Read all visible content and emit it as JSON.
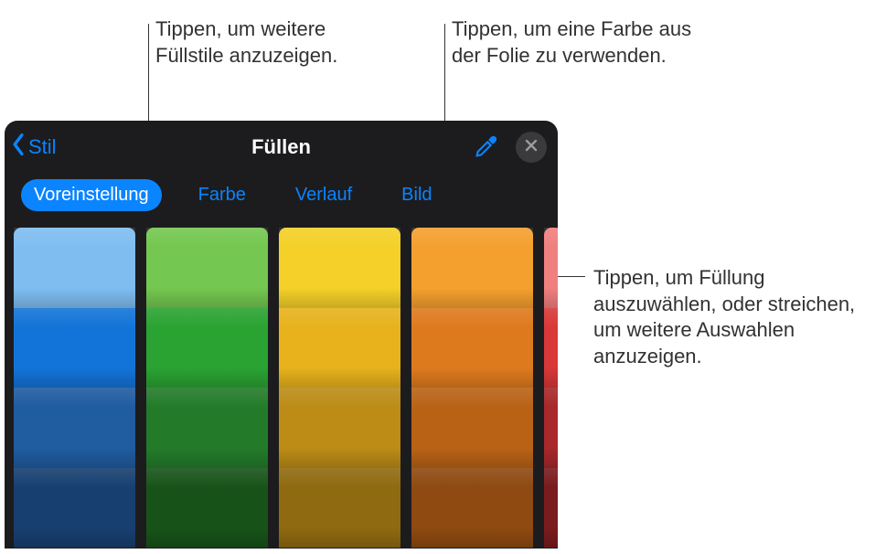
{
  "callouts": {
    "fillStyles": "Tippen, um weitere Füllstile anzuzeigen.",
    "eyedropper": "Tippen, um eine Farbe aus der Folie zu verwenden.",
    "swatches": "Tippen, um Füllung auszuwählen, oder streichen, um weitere Auswahlen anzuzeigen."
  },
  "panel": {
    "back_label": "Stil",
    "title": "Füllen",
    "tabs": [
      "Voreinstellung",
      "Farbe",
      "Verlauf",
      "Bild"
    ],
    "active_tab_index": 0,
    "swatch_columns": [
      [
        "#7fbdf0",
        "#1274d8",
        "#1f5ca0",
        "#173f70"
      ],
      [
        "#74c750",
        "#2aa332",
        "#237b2a",
        "#175319"
      ],
      [
        "#f4d028",
        "#e7b21c",
        "#bc8c16",
        "#8f6a10"
      ],
      [
        "#f4a02e",
        "#de7a1e",
        "#b96216",
        "#8e4a10"
      ],
      [
        "#f07f7f",
        "#d83838",
        "#a8282b",
        "#7a1b1d"
      ]
    ],
    "partial_last_column": true
  },
  "colors": {
    "accent": "#0a84ff",
    "panel_bg": "#1c1c1e",
    "close_bg": "#3a3a3c"
  }
}
